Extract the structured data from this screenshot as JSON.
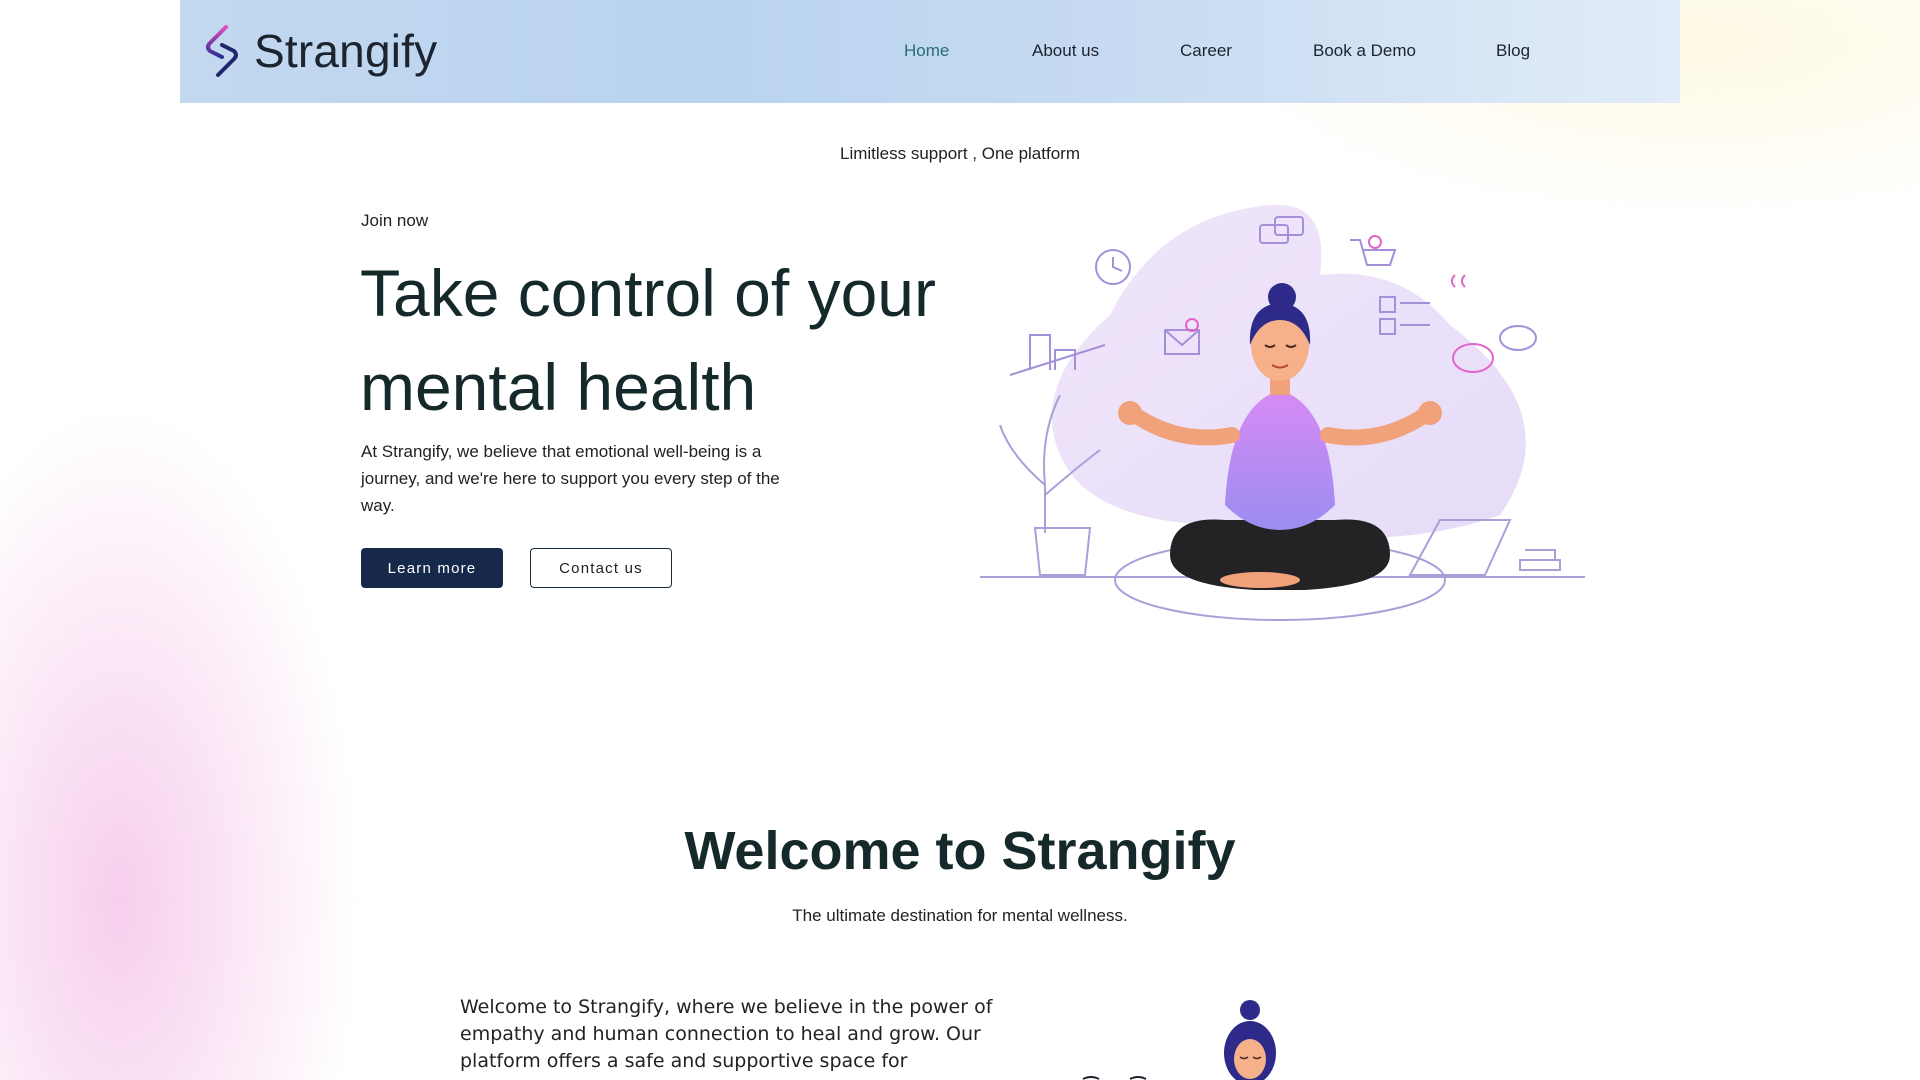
{
  "header": {
    "brand": "Strangify",
    "nav": [
      {
        "label": "Home",
        "active": true
      },
      {
        "label": "About us"
      },
      {
        "label": "Career"
      },
      {
        "label": "Book a Demo"
      },
      {
        "label": "Blog"
      }
    ]
  },
  "hero": {
    "tagline": "Limitless support , One platform",
    "join": "Join now",
    "title": "Take control of your mental health",
    "text": "At Strangify, we believe that emotional well-being is a journey, and we're here to support you every step of the way.",
    "primary_button": "Learn more",
    "secondary_button": "Contact us",
    "illustration_icon": "meditating-woman-illustration"
  },
  "welcome": {
    "title": "Welcome to Strangify",
    "subtitle": "The ultimate destination for mental wellness.",
    "body": "Welcome to Strangify, where we believe in the power of empathy and human connection to heal and grow. Our platform offers a safe and supportive space for individuals to",
    "illustration_icon": "woman-avatar-illustration"
  },
  "colors": {
    "nav_active": "#2b6e72",
    "primary_button": "#16294a",
    "accent_purple": "#c98af2",
    "accent_pink": "#e066c8"
  }
}
